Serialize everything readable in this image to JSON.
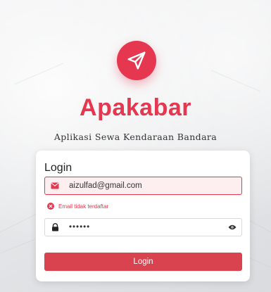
{
  "brand": {
    "name": "Apakabar",
    "tagline": "Aplikasi Sewa Kendaraan Bandara",
    "color": "#e5374f",
    "logo_icon": "paper-plane-icon"
  },
  "login_form": {
    "title": "Login",
    "email": {
      "value": "aizulfad@gmail.com",
      "icon": "envelope-icon",
      "state": "error"
    },
    "error_message": "Email tidak terdaftar",
    "error_icon": "error-x-icon",
    "password": {
      "value": "••••••",
      "icon": "lock-icon",
      "toggle_icon": "eye-icon"
    },
    "submit_label": "Login",
    "button_color": "#d9434f"
  }
}
